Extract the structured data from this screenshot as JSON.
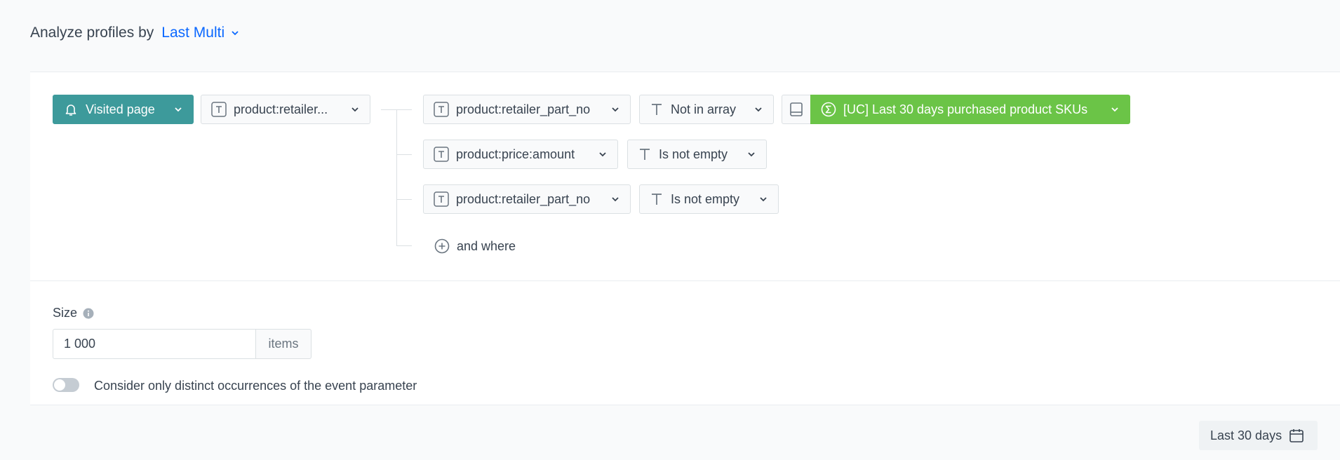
{
  "header": {
    "label": "Analyze profiles by",
    "selected": "Last Multi"
  },
  "event": {
    "label": "Visited page",
    "parameter": "product:retailer..."
  },
  "conditions": [
    {
      "field": "product:retailer_part_no",
      "operator": "Not in array",
      "value": "[UC] Last 30 days purchased product SKUs"
    },
    {
      "field": "product:price:amount",
      "operator": "Is not empty"
    },
    {
      "field": "product:retailer_part_no",
      "operator": "Is not empty"
    }
  ],
  "and_where": "and where",
  "size": {
    "label": "Size",
    "value": "1 000",
    "unit": "items"
  },
  "toggle": {
    "label": "Consider only distinct occurrences of the event parameter",
    "on": false
  },
  "date_range": "Last 30 days",
  "colors": {
    "accent": "#0b68ff",
    "event": "#3d9a9b",
    "value": "#6bc447"
  }
}
